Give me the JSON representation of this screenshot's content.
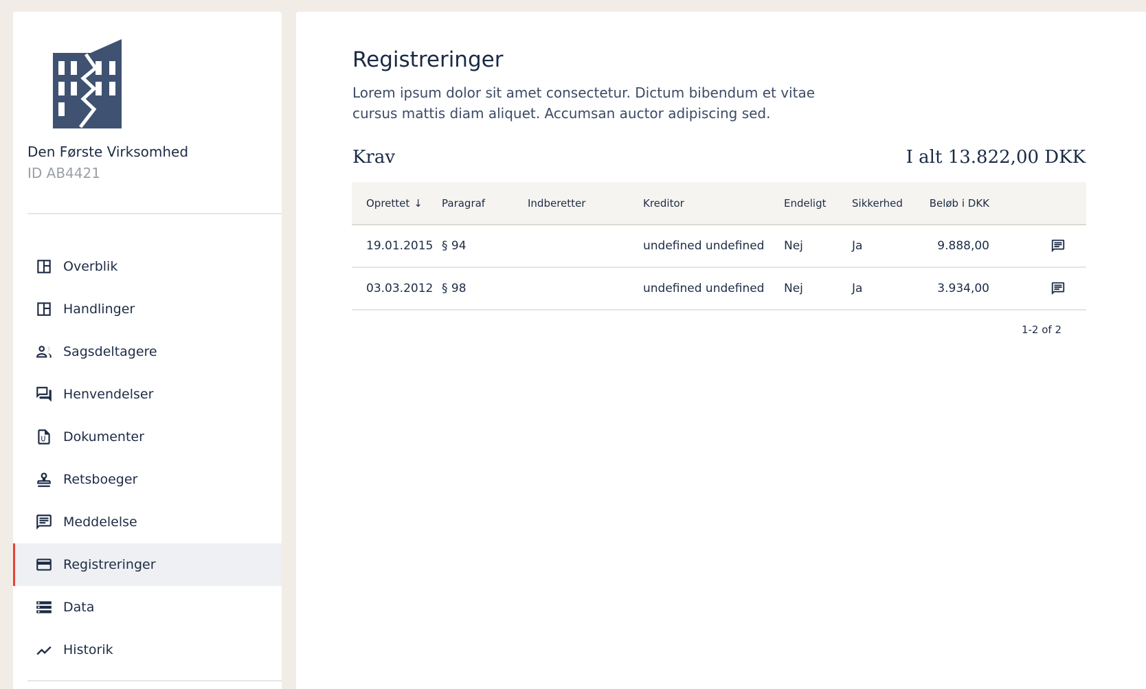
{
  "organization": {
    "name": "Den Første Virksomhed",
    "id_label": "ID AB4421"
  },
  "nav": {
    "items": [
      {
        "label": "Overblik",
        "icon": "dashboard-icon"
      },
      {
        "label": "Handlinger",
        "icon": "dashboard-icon"
      },
      {
        "label": "Sagsdeltagere",
        "icon": "people-icon"
      },
      {
        "label": "Henvendelser",
        "icon": "forum-icon"
      },
      {
        "label": "Dokumenter",
        "icon": "document-attachment-icon"
      },
      {
        "label": "Retsboeger",
        "icon": "stamp-icon"
      },
      {
        "label": "Meddelelse",
        "icon": "message-icon"
      },
      {
        "label": "Registreringer",
        "icon": "credit-card-icon"
      },
      {
        "label": "Data",
        "icon": "storage-icon"
      },
      {
        "label": "Historik",
        "icon": "trend-icon"
      }
    ],
    "active_index": 7
  },
  "main": {
    "title": "Registreringer",
    "description": "Lorem ipsum dolor sit amet consectetur. Dictum bibendum et vitae cursus mattis diam aliquet. Accumsan auctor adipiscing sed.",
    "section_title": "Krav",
    "total": "I alt 13.822,00 DKK"
  },
  "table": {
    "headers": [
      "Oprettet",
      "Paragraf",
      "Indberetter",
      "Kreditor",
      "Endeligt",
      "Sikkerhed",
      "Beløb i DKK"
    ],
    "sort_icon": "arrow-down-icon",
    "rows": [
      {
        "oprettet": "19.01.2015",
        "paragraf": "§ 94",
        "indberetter": "",
        "kreditor": "undefined undefined",
        "endeligt": "Nej",
        "sikkerhed": "Ja",
        "beloeb": "9.888,00"
      },
      {
        "oprettet": "03.03.2012",
        "paragraf": "§ 98",
        "indberetter": "",
        "kreditor": "undefined undefined",
        "endeligt": "Nej",
        "sikkerhed": "Ja",
        "beloeb": "3.934,00"
      }
    ],
    "pagination": "1-2 of 2"
  },
  "colors": {
    "background": "#f1ede6",
    "accent": "#e4423c",
    "text": "#1a2a44",
    "logo": "#3f5272"
  }
}
